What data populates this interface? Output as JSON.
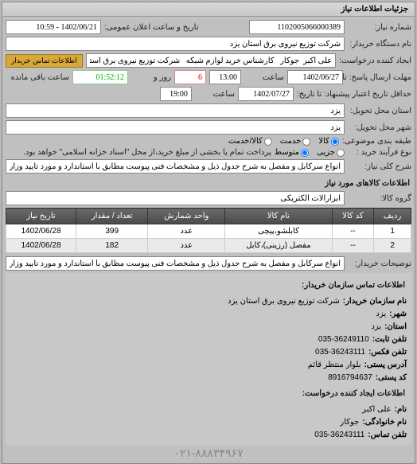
{
  "panel_title": "جزئیات اطلاعات نیاز",
  "req_no_label": "شماره نیاز:",
  "req_no": "1102005066000389",
  "announce_label": "تاریخ و ساعت اعلان عمومی:",
  "announce_value": "1402/06/21 - 10:59",
  "dept_label": "نام دستگاه خریدار:",
  "dept_value": "شرکت توزیع نیروی برق استان یزد",
  "creator_label": "ایجاد کننده درخواست:",
  "creator_value": "علی اکبر  جوکار   کارشناس خرید لوازم شبکه   شرکت توزیع نیروی برق استان یزد",
  "contact_btn": "اطلاعات تماس خریدار",
  "deadline_label": "مهلت ارسال پاسخ: تا تاریخ:",
  "deadline_date": "1402/06/27",
  "time_label": "ساعت",
  "deadline_time": "13:00",
  "days_label": "روز و",
  "days_value": "6",
  "remain_label": "ساعت باقی مانده",
  "remain_value": "01:52:12",
  "min_valid_label": "حداقل تاریخ اعتبار پیشنهاد: تا تاریخ:",
  "min_valid_date": "1402/07/27",
  "min_valid_time": "19:00",
  "deliver_prov_label": "استان محل تحویل:",
  "deliver_prov": "یزد",
  "deliver_city_label": "شهر محل تحویل:",
  "deliver_city": "یزد",
  "need_type_label": "طبقه بندی موضوعی:",
  "need_type_opts": {
    "goods": "کالا",
    "service": "خدمت",
    "both": "کالا/خدمت"
  },
  "process_label": "نوع فرآیند خرید :",
  "process_opts": {
    "partial": "جزیی",
    "medium": "متوسط"
  },
  "process_note": "پرداخت تمام یا بخشی از مبلغ خرید،از محل \"اسناد خزانه اسلامی\" خواهد بود.",
  "subject_label": "شرح کلی نیاز:",
  "subject_value": "انواع سرکابل و مفصل به شرح جدول ذیل و مشخصات فنی پیوست مطابق با استاندارد و مورد تایید وزارت نیرو",
  "goods_section": "اطلاعات کالاهای مورد نیاز",
  "group_label": "گروه کالا:",
  "group_value": "ابزارآلات الکتریکی",
  "table": {
    "headers": [
      "ردیف",
      "کد کالا",
      "نام کالا",
      "واحد شمارش",
      "تعداد / مقدار",
      "تاریخ نیاز"
    ],
    "rows": [
      {
        "idx": "1",
        "code": "--",
        "name": "کابلشو،پیچی",
        "unit": "عدد",
        "qty": "399",
        "date": "1402/06/28"
      },
      {
        "idx": "2",
        "code": "--",
        "name": "مفصل (رزینی)،کابل",
        "unit": "عدد",
        "qty": "182",
        "date": "1402/06/28"
      }
    ]
  },
  "buyer_note_label": "توضیحات خریدار:",
  "buyer_note": "انواع سرکابل و مفصل به شرح جدول ذیل و مشخصات فنی پیوست مطابق با استاندارد و مورد تایید وزارت نیرو",
  "contact_section": "اطلاعات تماس سازمان خریدار:",
  "org_name_lbl": "نام سازمان خریدار:",
  "org_name": "شرکت توزیع نیروی برق استان یزد",
  "city_lbl": "شهر:",
  "city": "یزد",
  "prov_lbl": "استان:",
  "prov": "یزد",
  "phone_lbl": "تلفن ثابت:",
  "phone": "035-36249110",
  "fax_lbl": "تلفن فکس:",
  "fax": "035-36243111",
  "addr_lbl": "آدرس پستی:",
  "addr": "بلوار منتظر قائم",
  "post_lbl": "کد پستی:",
  "post": "8916794637",
  "creator_section": "اطلاعات ایجاد کننده درخواست:",
  "fname_lbl": "نام:",
  "fname": "علی اکبر",
  "lname_lbl": "نام خانوادگی:",
  "lname": "جوکار",
  "cphone_lbl": "تلفن تماس:",
  "cphone": "035-36243111",
  "footer_phone": "۰۲۱-۸۸۸۳۴۹۶۷"
}
